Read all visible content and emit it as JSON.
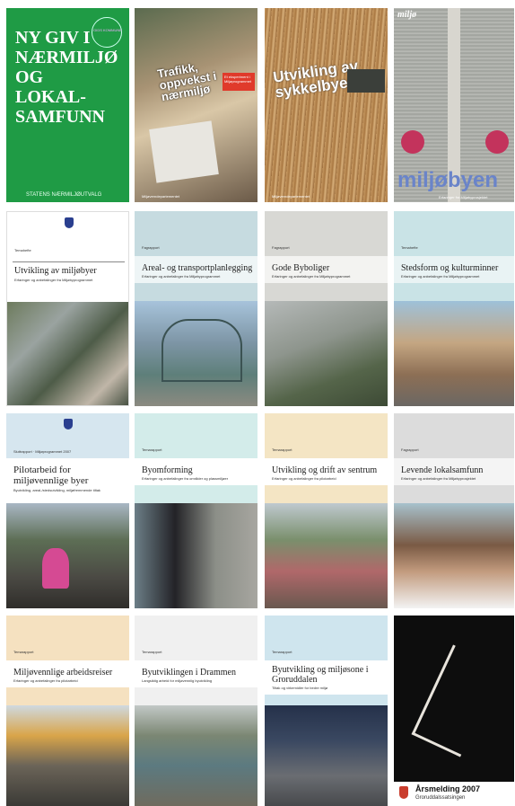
{
  "covers": {
    "c1": {
      "title": "NY GIV I NÆRMILJØ OG LOKAL-SAMFUNN",
      "badge": "GIDS KOMMUNE",
      "publisher": "STATENS NÆRMILJØUTVALG",
      "color": "#1f9b45"
    },
    "c2": {
      "title": "Trafikk, oppvekst i nærmiljø",
      "subtitle": "Et eksperiment i Miljøprogrammet",
      "footer": "Miljøverndepartementet"
    },
    "c3": {
      "title": "Utvikling av sykkelbyer",
      "footer": "Miljøverndepartementet"
    },
    "c4": {
      "header": "miljø",
      "title": "miljøbyen",
      "footer": "Erfaringer fra Miljøbyprosjektet"
    },
    "c5": {
      "label": "Temahefte",
      "title": "Utvikling av miljøbyer",
      "subtitle": "Erfaringer og anbefalinger fra Miljøbyprogrammet"
    },
    "c6": {
      "label": "Fagrapport",
      "title": "Areal- og transportplanlegging",
      "subtitle": "Erfaringer og anbefalinger fra Miljøbyprogrammet"
    },
    "c7": {
      "label": "Fagrapport",
      "title": "Gode Byboliger",
      "subtitle": "Erfaringer og anbefalinger fra Miljøbyprogrammet"
    },
    "c8": {
      "label": "Temahefte",
      "title": "Stedsform og kulturminner",
      "subtitle": "Erfaringer og anbefalinger fra Miljøbyprogrammet"
    },
    "c9": {
      "label": "Sluttrapport · Miljøprogrammet 2007",
      "title": "Pilotarbeid for miljøvennlige byer",
      "subtitle": "Byutvikling, areal-/stedsutvikling, miljøfremmende tiltak"
    },
    "c10": {
      "label": "Temarapport",
      "title": "Byomforming",
      "subtitle": "Erfaringer og anbefalinger fra områder og plassmiljøer"
    },
    "c11": {
      "label": "Temarapport",
      "title": "Utvikling og drift av sentrum",
      "subtitle": "Erfaringer og anbefalinger fra pilotarbeid"
    },
    "c12": {
      "label": "Fagrapport",
      "title": "Levende lokalsamfunn",
      "subtitle": "Erfaringer og anbefalinger fra Miljøbyprosjektet"
    },
    "c13": {
      "label": "Temarapport",
      "title": "Miljøvennlige arbeidsreiser",
      "subtitle": "Erfaringer og anbefalinger fra pilotarbeid"
    },
    "c14": {
      "label": "Temarapport",
      "title": "Byutviklingen i Drammen",
      "subtitle": "Langsiktig arbeid for miljøvennlig byutvikling"
    },
    "c15": {
      "label": "Temarapport",
      "title": "Byutvikling og miljøsone i Groruddalen",
      "subtitle": "Tiltak og virkemidler for bedre miljø"
    },
    "c16": {
      "title": "Årsmelding 2007",
      "subtitle": "Groruddalssatsingen"
    }
  }
}
